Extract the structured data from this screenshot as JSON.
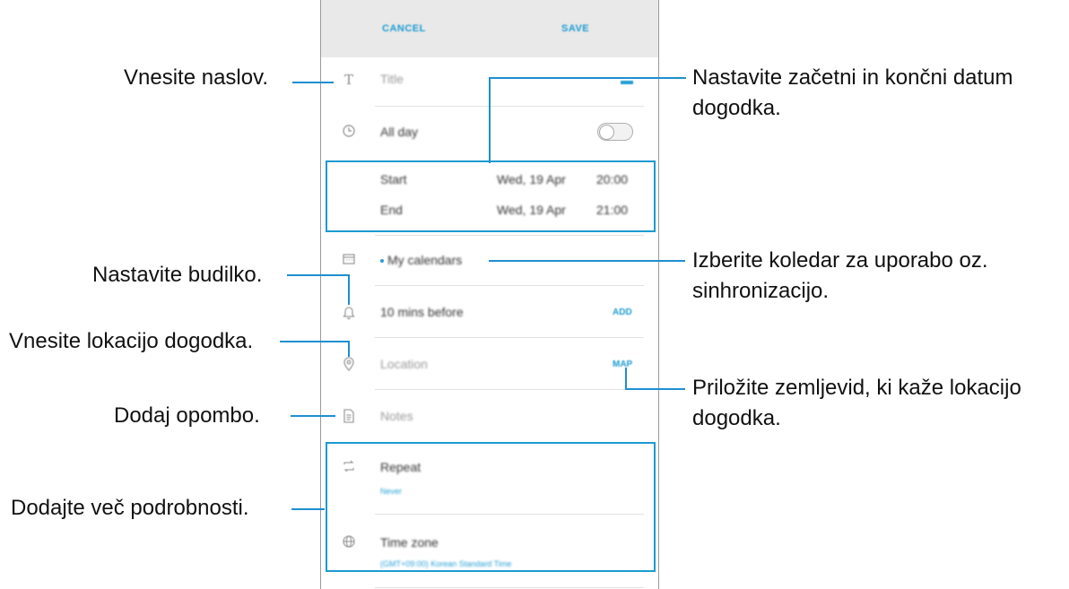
{
  "header": {
    "cancel": "CANCEL",
    "save": "SAVE"
  },
  "form": {
    "title_placeholder": "Title",
    "allday_label": "All day",
    "start_label": "Start",
    "start_date": "Wed, 19 Apr",
    "start_time": "20:00",
    "end_label": "End",
    "end_date": "Wed, 19 Apr",
    "end_time": "21:00",
    "calendar": "My calendars",
    "alarm": "10 mins before",
    "alarm_add": "ADD",
    "location_placeholder": "Location",
    "map_button": "MAP",
    "notes_placeholder": "Notes",
    "repeat_label": "Repeat",
    "repeat_value": "Never",
    "timezone_label": "Time zone",
    "timezone_value": "(GMT+09:00) Korean Standard Time"
  },
  "annotations": {
    "title": "Vnesite naslov.",
    "date_line1": "Nastavite začetni in končni datum",
    "date_line2": "dogodka.",
    "alarm": "Nastavite budilko.",
    "calendar_line1": "Izberite koledar za uporabo oz.",
    "calendar_line2": "sinhronizacijo.",
    "location": "Vnesite lokacijo dogodka.",
    "map_line1": "Priložite zemljevid, ki kaže lokacijo",
    "map_line2": "dogodka.",
    "notes": "Dodaj opombo.",
    "more": "Dodajte več podrobnosti."
  },
  "colors": {
    "accent": "#1c9bd1",
    "annotation_line": "#1e8fd0",
    "header_bg": "#e9e9e9"
  },
  "icons": [
    "text-icon",
    "clock-icon",
    "calendar-icon",
    "bell-icon",
    "location-pin-icon",
    "note-icon",
    "repeat-icon",
    "globe-icon"
  ]
}
